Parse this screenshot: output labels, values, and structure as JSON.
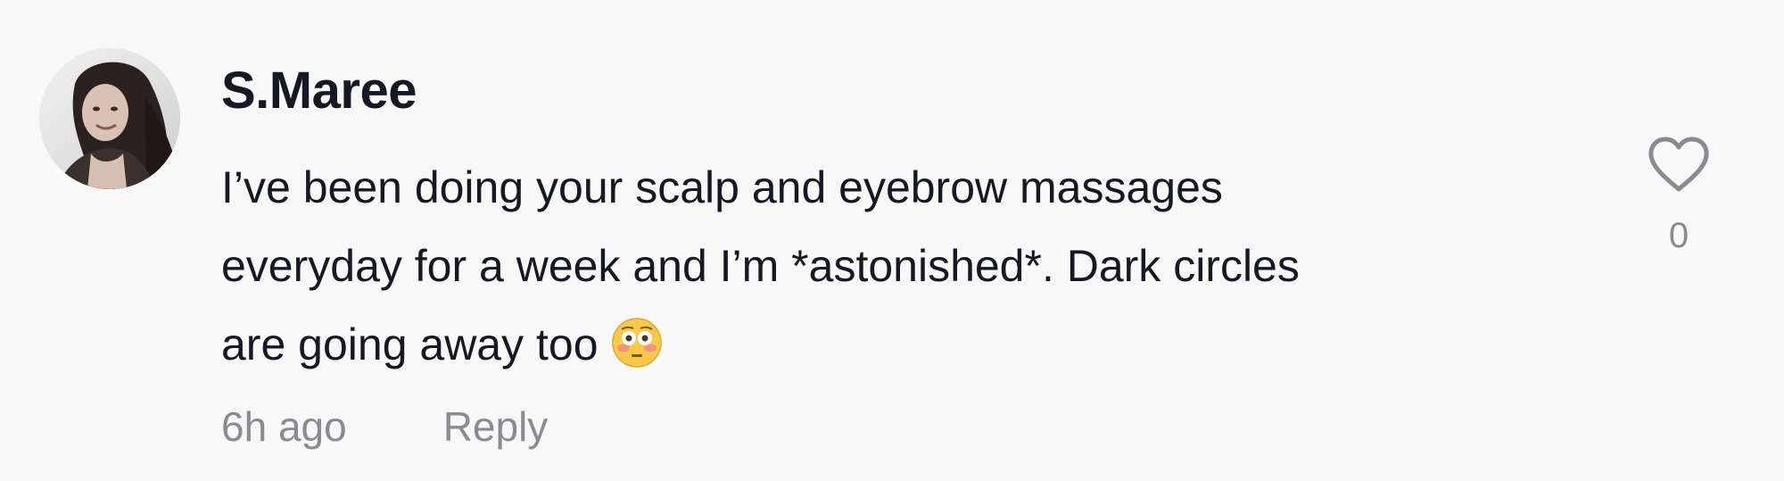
{
  "comment": {
    "username": "S.Maree",
    "text_lines": [
      "I’ve been doing your scalp and eyebrow massages",
      "everyday for a week and I’m *astonished*. Dark circles",
      "are going away too"
    ],
    "emoji": "😳",
    "timestamp": "6h ago",
    "reply_label": "Reply",
    "like_count": "0",
    "like_icon": "heart-outline-icon",
    "avatar": "profile-photo"
  },
  "colors": {
    "background": "#f8f8f8",
    "primary_text": "#161823",
    "secondary_text": "#8a8b91"
  }
}
